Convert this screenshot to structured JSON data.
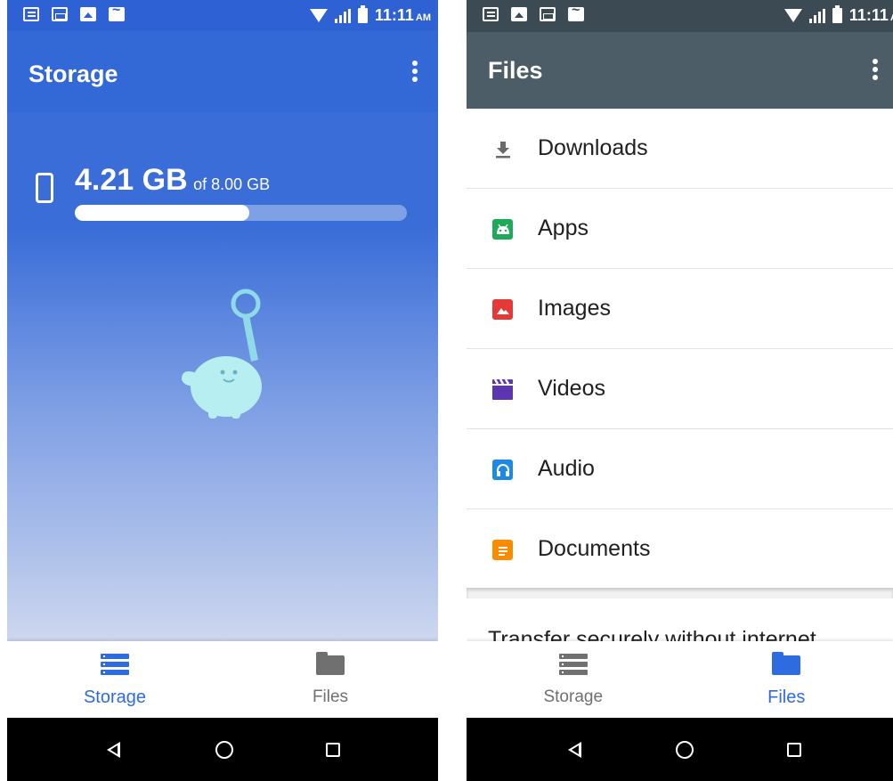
{
  "status_bar": {
    "time": "11:11",
    "ampm": "AM"
  },
  "storage_screen": {
    "title": "Storage",
    "used": "4.21 GB",
    "total": "of 8.00 GB",
    "used_fraction": 0.526
  },
  "files_screen": {
    "title": "Files",
    "categories": [
      {
        "label": "Downloads",
        "icon": "download-icon",
        "color": "#6b6b6b"
      },
      {
        "label": "Apps",
        "icon": "android-icon",
        "color": "#1faa5a"
      },
      {
        "label": "Images",
        "icon": "image-icon",
        "color": "#e53935"
      },
      {
        "label": "Videos",
        "icon": "clapperboard-icon",
        "color": "#5e35b1"
      },
      {
        "label": "Audio",
        "icon": "headphones-icon",
        "color": "#1e88e5"
      },
      {
        "label": "Documents",
        "icon": "document-icon",
        "color": "#fb8c00"
      }
    ],
    "transfer_text": "Transfer securely without internet"
  },
  "bottom_nav": {
    "storage_label": "Storage",
    "files_label": "Files"
  },
  "colors": {
    "accent": "#2e6be0",
    "inactive": "#707070"
  }
}
